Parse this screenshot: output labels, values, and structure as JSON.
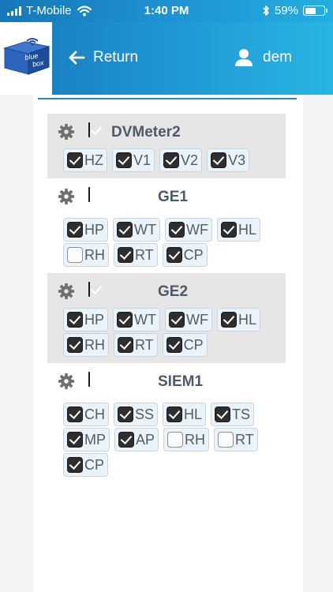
{
  "status_bar": {
    "carrier": "T-Mobile",
    "time": "1:40 PM",
    "battery": "59%",
    "battery_level": 0.59,
    "icons": [
      "signal-icon",
      "wifi-icon",
      "bluetooth-icon",
      "battery-icon"
    ]
  },
  "header": {
    "logo_text_top": "blue",
    "logo_text_bottom": "box",
    "back_label": "Return",
    "username": "dem"
  },
  "colors": {
    "header_gradient_start": "#1679bb",
    "header_gradient_end": "#27b5e2",
    "accent_line": "#1f8ccc",
    "device_name": "#4c5a69"
  },
  "devices": [
    {
      "name": "DVMeter2",
      "checked": true,
      "shaded": true,
      "name_align": "left",
      "tags": [
        {
          "label": "HZ",
          "checked": true
        },
        {
          "label": "V1",
          "checked": true
        },
        {
          "label": "V2",
          "checked": true
        },
        {
          "label": "V3",
          "checked": true
        }
      ]
    },
    {
      "name": "GE1",
      "checked": true,
      "shaded": false,
      "name_align": "center",
      "tags": [
        {
          "label": "HP",
          "checked": true
        },
        {
          "label": "WT",
          "checked": true
        },
        {
          "label": "WF",
          "checked": true
        },
        {
          "label": "HL",
          "checked": true
        },
        {
          "label": "RH",
          "checked": false
        },
        {
          "label": "RT",
          "checked": true
        },
        {
          "label": "CP",
          "checked": true
        }
      ]
    },
    {
      "name": "GE2",
      "checked": true,
      "shaded": true,
      "name_align": "center",
      "tags": [
        {
          "label": "HP",
          "checked": true
        },
        {
          "label": "WT",
          "checked": true
        },
        {
          "label": "WF",
          "checked": true
        },
        {
          "label": "HL",
          "checked": true
        },
        {
          "label": "RH",
          "checked": true
        },
        {
          "label": "RT",
          "checked": true
        },
        {
          "label": "CP",
          "checked": true
        }
      ]
    },
    {
      "name": "SIEM1",
      "checked": true,
      "shaded": false,
      "name_align": "center",
      "tags": [
        {
          "label": "CH",
          "checked": true
        },
        {
          "label": "SS",
          "checked": true
        },
        {
          "label": "HL",
          "checked": true
        },
        {
          "label": "TS",
          "checked": true
        },
        {
          "label": "MP",
          "checked": true
        },
        {
          "label": "AP",
          "checked": true
        },
        {
          "label": "RH",
          "checked": false
        },
        {
          "label": "RT",
          "checked": false
        },
        {
          "label": "CP",
          "checked": true
        }
      ]
    }
  ]
}
